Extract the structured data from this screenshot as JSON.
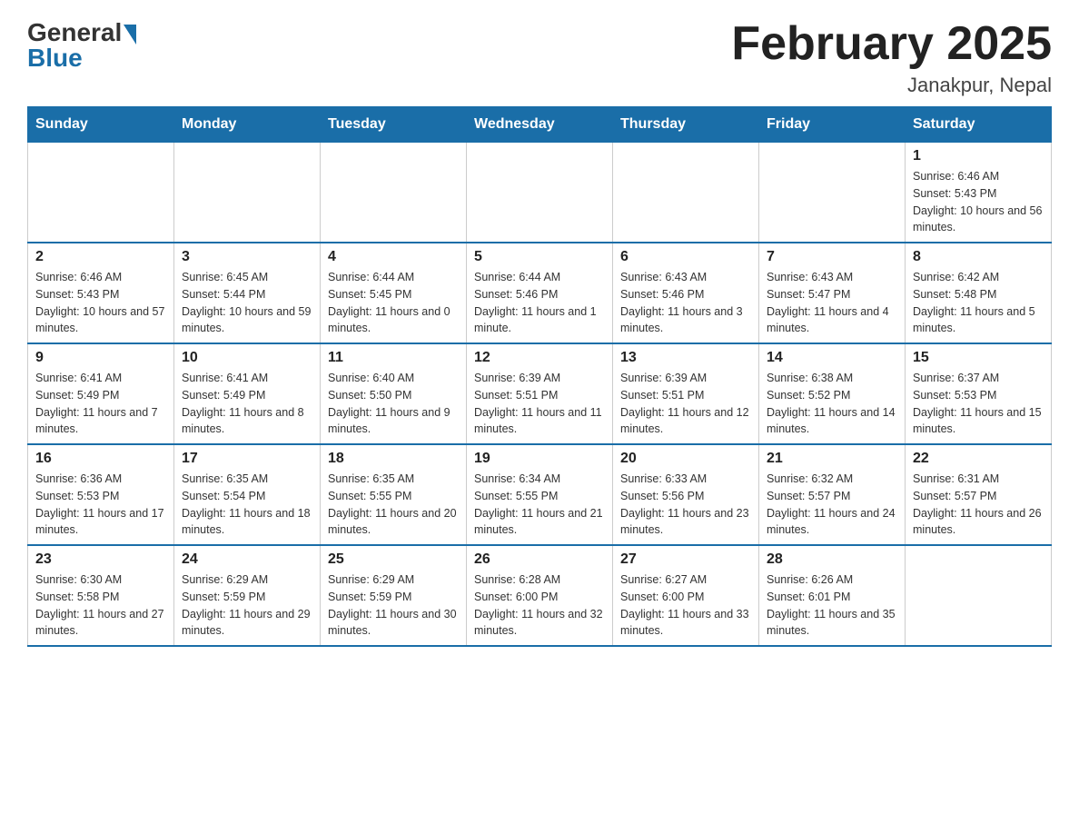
{
  "header": {
    "logo_general": "General",
    "logo_blue": "Blue",
    "month_title": "February 2025",
    "location": "Janakpur, Nepal"
  },
  "days_of_week": [
    "Sunday",
    "Monday",
    "Tuesday",
    "Wednesday",
    "Thursday",
    "Friday",
    "Saturday"
  ],
  "weeks": [
    {
      "cells": [
        {
          "day": "",
          "info": ""
        },
        {
          "day": "",
          "info": ""
        },
        {
          "day": "",
          "info": ""
        },
        {
          "day": "",
          "info": ""
        },
        {
          "day": "",
          "info": ""
        },
        {
          "day": "",
          "info": ""
        },
        {
          "day": "1",
          "info": "Sunrise: 6:46 AM\nSunset: 5:43 PM\nDaylight: 10 hours and 56 minutes."
        }
      ]
    },
    {
      "cells": [
        {
          "day": "2",
          "info": "Sunrise: 6:46 AM\nSunset: 5:43 PM\nDaylight: 10 hours and 57 minutes."
        },
        {
          "day": "3",
          "info": "Sunrise: 6:45 AM\nSunset: 5:44 PM\nDaylight: 10 hours and 59 minutes."
        },
        {
          "day": "4",
          "info": "Sunrise: 6:44 AM\nSunset: 5:45 PM\nDaylight: 11 hours and 0 minutes."
        },
        {
          "day": "5",
          "info": "Sunrise: 6:44 AM\nSunset: 5:46 PM\nDaylight: 11 hours and 1 minute."
        },
        {
          "day": "6",
          "info": "Sunrise: 6:43 AM\nSunset: 5:46 PM\nDaylight: 11 hours and 3 minutes."
        },
        {
          "day": "7",
          "info": "Sunrise: 6:43 AM\nSunset: 5:47 PM\nDaylight: 11 hours and 4 minutes."
        },
        {
          "day": "8",
          "info": "Sunrise: 6:42 AM\nSunset: 5:48 PM\nDaylight: 11 hours and 5 minutes."
        }
      ]
    },
    {
      "cells": [
        {
          "day": "9",
          "info": "Sunrise: 6:41 AM\nSunset: 5:49 PM\nDaylight: 11 hours and 7 minutes."
        },
        {
          "day": "10",
          "info": "Sunrise: 6:41 AM\nSunset: 5:49 PM\nDaylight: 11 hours and 8 minutes."
        },
        {
          "day": "11",
          "info": "Sunrise: 6:40 AM\nSunset: 5:50 PM\nDaylight: 11 hours and 9 minutes."
        },
        {
          "day": "12",
          "info": "Sunrise: 6:39 AM\nSunset: 5:51 PM\nDaylight: 11 hours and 11 minutes."
        },
        {
          "day": "13",
          "info": "Sunrise: 6:39 AM\nSunset: 5:51 PM\nDaylight: 11 hours and 12 minutes."
        },
        {
          "day": "14",
          "info": "Sunrise: 6:38 AM\nSunset: 5:52 PM\nDaylight: 11 hours and 14 minutes."
        },
        {
          "day": "15",
          "info": "Sunrise: 6:37 AM\nSunset: 5:53 PM\nDaylight: 11 hours and 15 minutes."
        }
      ]
    },
    {
      "cells": [
        {
          "day": "16",
          "info": "Sunrise: 6:36 AM\nSunset: 5:53 PM\nDaylight: 11 hours and 17 minutes."
        },
        {
          "day": "17",
          "info": "Sunrise: 6:35 AM\nSunset: 5:54 PM\nDaylight: 11 hours and 18 minutes."
        },
        {
          "day": "18",
          "info": "Sunrise: 6:35 AM\nSunset: 5:55 PM\nDaylight: 11 hours and 20 minutes."
        },
        {
          "day": "19",
          "info": "Sunrise: 6:34 AM\nSunset: 5:55 PM\nDaylight: 11 hours and 21 minutes."
        },
        {
          "day": "20",
          "info": "Sunrise: 6:33 AM\nSunset: 5:56 PM\nDaylight: 11 hours and 23 minutes."
        },
        {
          "day": "21",
          "info": "Sunrise: 6:32 AM\nSunset: 5:57 PM\nDaylight: 11 hours and 24 minutes."
        },
        {
          "day": "22",
          "info": "Sunrise: 6:31 AM\nSunset: 5:57 PM\nDaylight: 11 hours and 26 minutes."
        }
      ]
    },
    {
      "cells": [
        {
          "day": "23",
          "info": "Sunrise: 6:30 AM\nSunset: 5:58 PM\nDaylight: 11 hours and 27 minutes."
        },
        {
          "day": "24",
          "info": "Sunrise: 6:29 AM\nSunset: 5:59 PM\nDaylight: 11 hours and 29 minutes."
        },
        {
          "day": "25",
          "info": "Sunrise: 6:29 AM\nSunset: 5:59 PM\nDaylight: 11 hours and 30 minutes."
        },
        {
          "day": "26",
          "info": "Sunrise: 6:28 AM\nSunset: 6:00 PM\nDaylight: 11 hours and 32 minutes."
        },
        {
          "day": "27",
          "info": "Sunrise: 6:27 AM\nSunset: 6:00 PM\nDaylight: 11 hours and 33 minutes."
        },
        {
          "day": "28",
          "info": "Sunrise: 6:26 AM\nSunset: 6:01 PM\nDaylight: 11 hours and 35 minutes."
        },
        {
          "day": "",
          "info": ""
        }
      ]
    }
  ]
}
